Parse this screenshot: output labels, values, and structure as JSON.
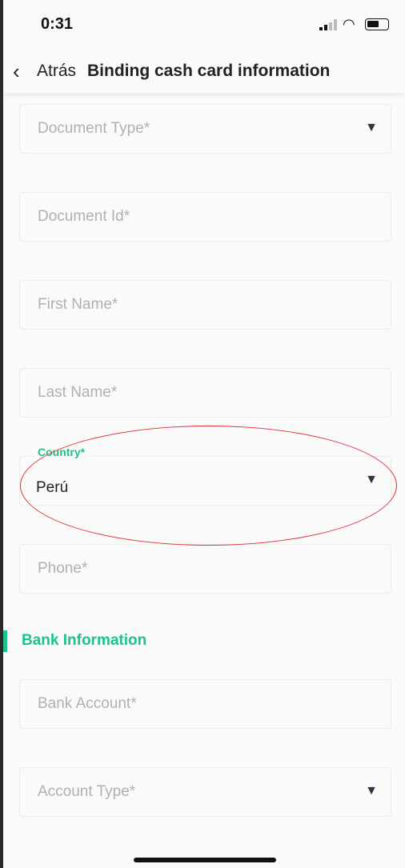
{
  "status_bar": {
    "time": "0:31",
    "icons": [
      "signal-icon",
      "wifi-icon",
      "battery-icon"
    ]
  },
  "header": {
    "back_label": "Atrás",
    "title": "Binding cash card information"
  },
  "fields": [
    {
      "placeholder": "Document Type*",
      "type": "select"
    },
    {
      "placeholder": "Document Id*",
      "type": "text"
    },
    {
      "placeholder": "First Name*",
      "type": "text"
    },
    {
      "placeholder": "Last Name*",
      "type": "text"
    },
    {
      "label": "Country*",
      "value": "Perú",
      "type": "select"
    },
    {
      "placeholder": "Phone*",
      "type": "text"
    }
  ],
  "bank_section": {
    "title": "Bank Information",
    "fields": [
      {
        "placeholder": "Bank Account*",
        "type": "text"
      },
      {
        "placeholder": "Account Type*",
        "type": "select"
      }
    ]
  },
  "colors": {
    "accent": "#1fc28a",
    "annotation": "#e0303a"
  }
}
